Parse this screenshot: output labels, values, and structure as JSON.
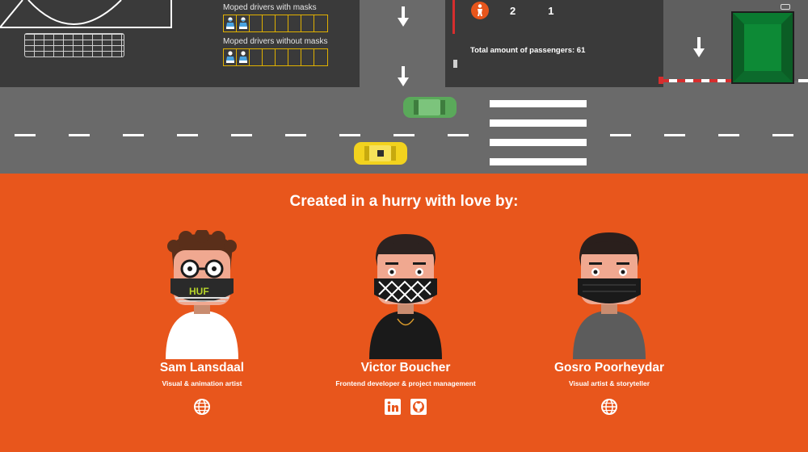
{
  "scene": {
    "masks_with_label": "Moped drivers with masks",
    "masks_without_label": "Moped drivers without masks",
    "masks_with_count": 2,
    "masks_without_count": 2,
    "slots_per_row": 8,
    "counter_a": "2",
    "counter_b": "1",
    "total_passengers": "Total amount of passengers: 61"
  },
  "credits": {
    "heading": "Created in a hurry with love by:",
    "people": [
      {
        "name": "Sam Lansdaal",
        "role": "Visual & animation artist",
        "mask_text": "HUF",
        "links": [
          "website-icon"
        ]
      },
      {
        "name": "Victor Boucher",
        "role": "Frontend developer & project management",
        "links": [
          "linkedin-icon",
          "github-icon"
        ]
      },
      {
        "name": "Gosro Poorheydar",
        "role": "Visual artist & storyteller",
        "links": [
          "website-icon"
        ]
      }
    ]
  },
  "colors": {
    "background": "#e8561c",
    "road": "#6a6a6a",
    "block": "#3a3a3a",
    "green_car": "#5aa95a",
    "yellow_car": "#f2d21e",
    "gate": "#0c6a2c",
    "grid_border": "#e0b000"
  }
}
